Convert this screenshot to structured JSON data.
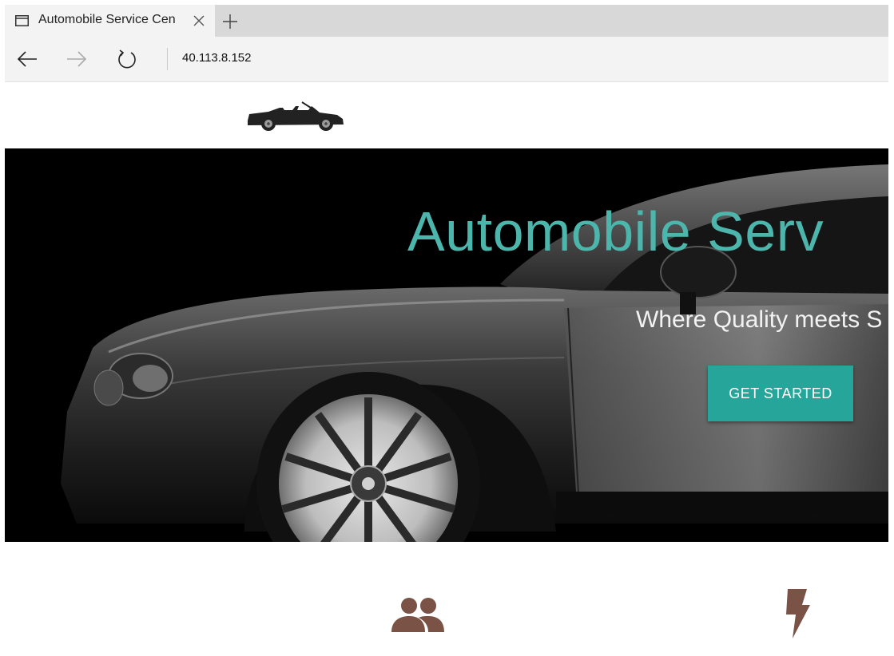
{
  "browser": {
    "tab_title": "Automobile Service Cen",
    "address": "40.113.8.152"
  },
  "hero": {
    "title": "Automobile Serv",
    "subtitle": "Where Quality meets S",
    "cta_label": "GET STARTED"
  },
  "colors": {
    "accent_teal": "#26a69a",
    "title_teal": "#4db6ac",
    "icon_brown": "#7b5246"
  },
  "icons": {
    "logo": "convertible-car-icon",
    "feature_1": "group-icon",
    "feature_2": "flash-icon"
  }
}
